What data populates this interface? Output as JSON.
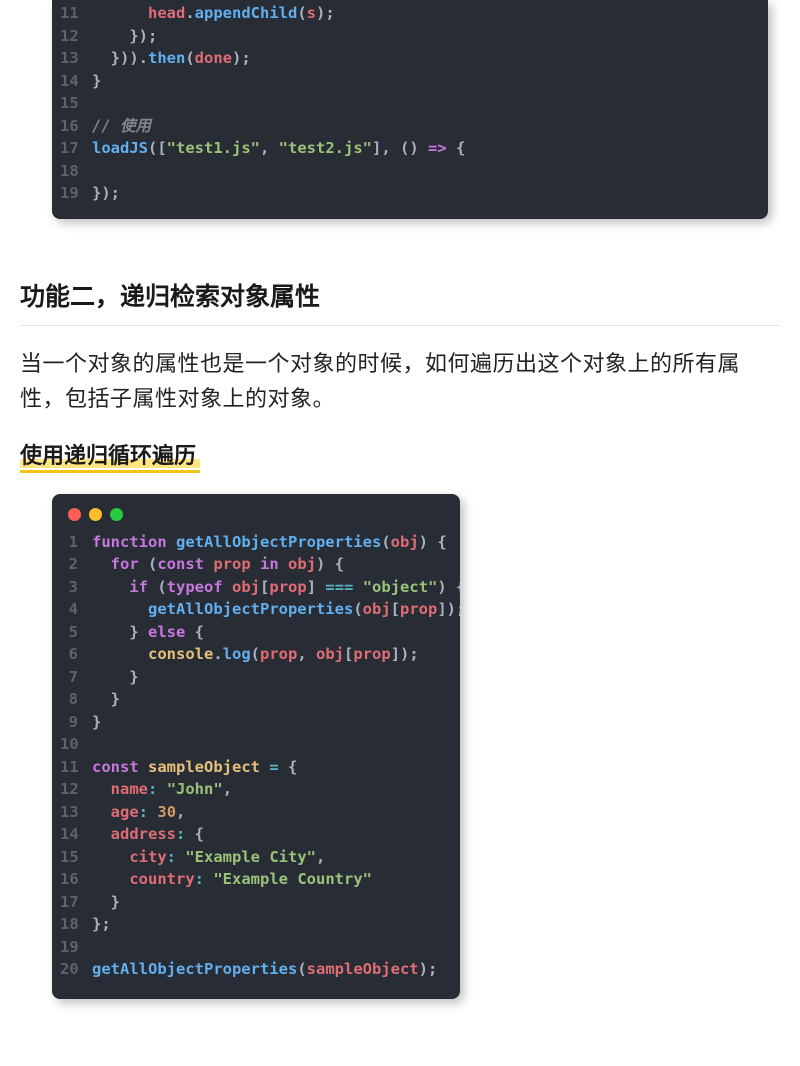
{
  "codeBlock1": {
    "startLine": 11,
    "lines": [
      [
        [
          "sp",
          "      "
        ],
        [
          "var",
          "head"
        ],
        [
          "p",
          "."
        ],
        [
          "method",
          "appendChild"
        ],
        [
          "p",
          "("
        ],
        [
          "var",
          "s"
        ],
        [
          "p",
          ");"
        ]
      ],
      [
        [
          "sp",
          "    "
        ],
        [
          "p",
          "});"
        ]
      ],
      [
        [
          "sp",
          "  "
        ],
        [
          "p",
          "}))."
        ],
        [
          "method",
          "then"
        ],
        [
          "p",
          "("
        ],
        [
          "var",
          "done"
        ],
        [
          "p",
          ");"
        ]
      ],
      [
        [
          "p",
          "}"
        ]
      ],
      [],
      [
        [
          "cmt",
          "// 使用"
        ]
      ],
      [
        [
          "fn",
          "loadJS"
        ],
        [
          "p",
          "(["
        ],
        [
          "str",
          "\"test1.js\""
        ],
        [
          "p",
          ", "
        ],
        [
          "str",
          "\"test2.js\""
        ],
        [
          "p",
          "], () "
        ],
        [
          "kw",
          "=>"
        ],
        [
          "p",
          " {"
        ]
      ],
      [],
      [
        [
          "p",
          "});"
        ]
      ]
    ]
  },
  "heading2": "功能二，递归检索对象属性",
  "paragraph2": "当一个对象的属性也是一个对象的时候，如何遍历出这个对象上的所有属性，包括子属性对象上的对象。",
  "subheading2": "使用递归循环遍历",
  "codeBlock2": {
    "startLine": 1,
    "lines": [
      [
        [
          "kw",
          "function"
        ],
        [
          "sp",
          " "
        ],
        [
          "fn",
          "getAllObjectProperties"
        ],
        [
          "p",
          "("
        ],
        [
          "param",
          "obj"
        ],
        [
          "p",
          ") {"
        ]
      ],
      [
        [
          "sp",
          "  "
        ],
        [
          "kw",
          "for"
        ],
        [
          "p",
          " ("
        ],
        [
          "kw",
          "const"
        ],
        [
          "p",
          " "
        ],
        [
          "var",
          "prop"
        ],
        [
          "p",
          " "
        ],
        [
          "kw",
          "in"
        ],
        [
          "p",
          " "
        ],
        [
          "var",
          "obj"
        ],
        [
          "p",
          ") {"
        ]
      ],
      [
        [
          "sp",
          "    "
        ],
        [
          "kw",
          "if"
        ],
        [
          "p",
          " ("
        ],
        [
          "kw",
          "typeof"
        ],
        [
          "p",
          " "
        ],
        [
          "var",
          "obj"
        ],
        [
          "p",
          "["
        ],
        [
          "var",
          "prop"
        ],
        [
          "p",
          "] "
        ],
        [
          "op",
          "==="
        ],
        [
          "p",
          " "
        ],
        [
          "str",
          "\"object\""
        ],
        [
          "p",
          ") {"
        ]
      ],
      [
        [
          "sp",
          "      "
        ],
        [
          "fn",
          "getAllObjectProperties"
        ],
        [
          "p",
          "("
        ],
        [
          "var",
          "obj"
        ],
        [
          "p",
          "["
        ],
        [
          "var",
          "prop"
        ],
        [
          "p",
          "]);"
        ]
      ],
      [
        [
          "sp",
          "    "
        ],
        [
          "p",
          "} "
        ],
        [
          "kw",
          "else"
        ],
        [
          "p",
          " {"
        ]
      ],
      [
        [
          "sp",
          "      "
        ],
        [
          "this",
          "console"
        ],
        [
          "p",
          "."
        ],
        [
          "method",
          "log"
        ],
        [
          "p",
          "("
        ],
        [
          "var",
          "prop"
        ],
        [
          "p",
          ", "
        ],
        [
          "var",
          "obj"
        ],
        [
          "p",
          "["
        ],
        [
          "var",
          "prop"
        ],
        [
          "p",
          "]);"
        ]
      ],
      [
        [
          "sp",
          "    "
        ],
        [
          "p",
          "}"
        ]
      ],
      [
        [
          "sp",
          "  "
        ],
        [
          "p",
          "}"
        ]
      ],
      [
        [
          "p",
          "}"
        ]
      ],
      [],
      [
        [
          "kw",
          "const"
        ],
        [
          "sp",
          " "
        ],
        [
          "newvar",
          "sampleObject"
        ],
        [
          "p",
          " "
        ],
        [
          "op",
          "="
        ],
        [
          "p",
          " {"
        ]
      ],
      [
        [
          "sp",
          "  "
        ],
        [
          "attr",
          "name"
        ],
        [
          "op",
          ":"
        ],
        [
          "p",
          " "
        ],
        [
          "str",
          "\"John\""
        ],
        [
          "p",
          ","
        ]
      ],
      [
        [
          "sp",
          "  "
        ],
        [
          "attr",
          "age"
        ],
        [
          "op",
          ":"
        ],
        [
          "p",
          " "
        ],
        [
          "num",
          "30"
        ],
        [
          "p",
          ","
        ]
      ],
      [
        [
          "sp",
          "  "
        ],
        [
          "attr",
          "address"
        ],
        [
          "op",
          ":"
        ],
        [
          "p",
          " {"
        ]
      ],
      [
        [
          "sp",
          "    "
        ],
        [
          "attr",
          "city"
        ],
        [
          "op",
          ":"
        ],
        [
          "p",
          " "
        ],
        [
          "str",
          "\"Example City\""
        ],
        [
          "p",
          ","
        ]
      ],
      [
        [
          "sp",
          "    "
        ],
        [
          "attr",
          "country"
        ],
        [
          "op",
          ":"
        ],
        [
          "p",
          " "
        ],
        [
          "str",
          "\"Example Country\""
        ]
      ],
      [
        [
          "sp",
          "  "
        ],
        [
          "p",
          "}"
        ]
      ],
      [
        [
          "p",
          "};"
        ]
      ],
      [],
      [
        [
          "fn",
          "getAllObjectProperties"
        ],
        [
          "p",
          "("
        ],
        [
          "var",
          "sampleObject"
        ],
        [
          "p",
          ");"
        ]
      ]
    ]
  }
}
